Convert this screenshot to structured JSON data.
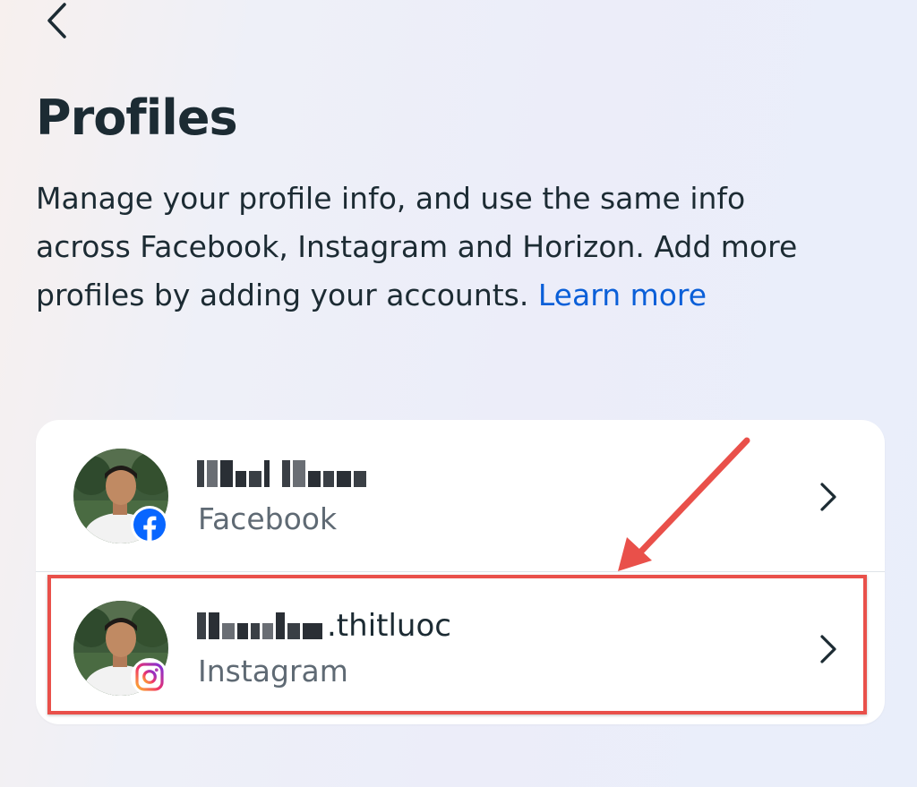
{
  "header": {
    "back_icon": "chevron-left-icon",
    "title": "Profiles"
  },
  "description": {
    "text": "Manage your profile info, and use the same info across Facebook, Instagram and Horizon. Add more profiles by adding your accounts.",
    "link_text": "Learn more"
  },
  "profiles": [
    {
      "name_visible": "",
      "platform": "Facebook",
      "badge_icon": "facebook-icon",
      "chevron_icon": "chevron-right-icon"
    },
    {
      "name_visible": ".thitluoc",
      "platform": "Instagram",
      "badge_icon": "instagram-icon",
      "chevron_icon": "chevron-right-icon"
    }
  ],
  "colors": {
    "link": "#0a5fd8",
    "text": "#1c2b33",
    "secondary_text": "#5f6a74",
    "annotation": "#e9504a",
    "facebook": "#0866ff"
  }
}
